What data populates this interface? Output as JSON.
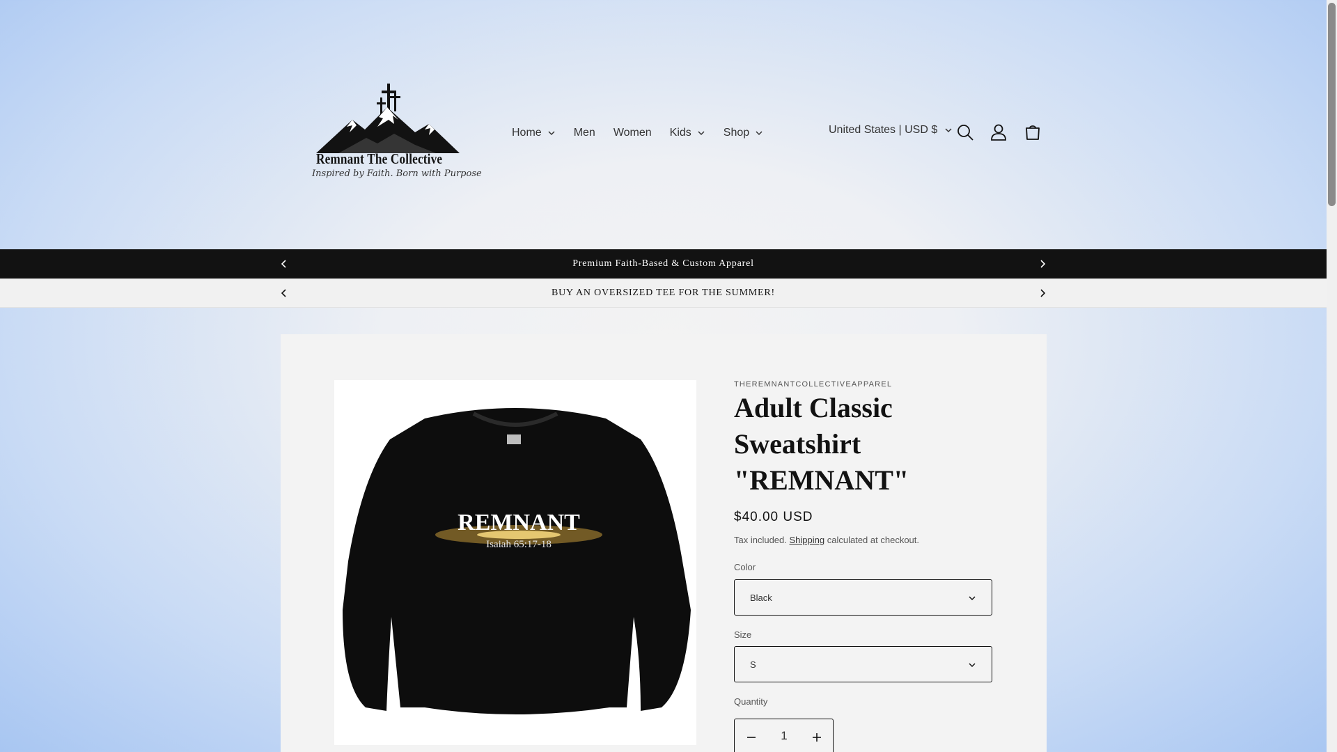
{
  "brand": {
    "name": "Remnant The Collective",
    "tagline": "Inspired by Faith. Born with Purpose"
  },
  "nav": {
    "items": [
      {
        "label": "Home",
        "has_dropdown": true
      },
      {
        "label": "Men",
        "has_dropdown": false
      },
      {
        "label": "Women",
        "has_dropdown": false
      },
      {
        "label": "Kids",
        "has_dropdown": true
      },
      {
        "label": "Shop",
        "has_dropdown": true
      }
    ]
  },
  "header": {
    "country_label": "United States | USD $",
    "icons": [
      "search-icon",
      "account-icon",
      "cart-icon"
    ]
  },
  "announcements": [
    {
      "text": "Premium Faith-Based & Custom Apparel"
    },
    {
      "text": "BUY AN OVERSIZED TEE FOR THE SUMMER!"
    }
  ],
  "product": {
    "vendor": "THEREMNANTCOLLECTIVEAPPAREL",
    "title": "Adult Classic Sweatshirt \"REMNANT\"",
    "price": "$40.00 USD",
    "tax_prefix": "Tax included.",
    "tax_link": "Shipping",
    "tax_suffix": "calculated at checkout.",
    "image_text": {
      "main": "REMNANT",
      "sub": "Isaiah 65:17-18"
    },
    "color": {
      "label": "Color",
      "value": "Black"
    },
    "size": {
      "label": "Size",
      "value": "S"
    },
    "quantity": {
      "label": "Quantity",
      "value": "1"
    }
  },
  "colors": {
    "text": "#121212",
    "announcement_dark": "#121212",
    "announcement_light": "#f1f1f1"
  }
}
